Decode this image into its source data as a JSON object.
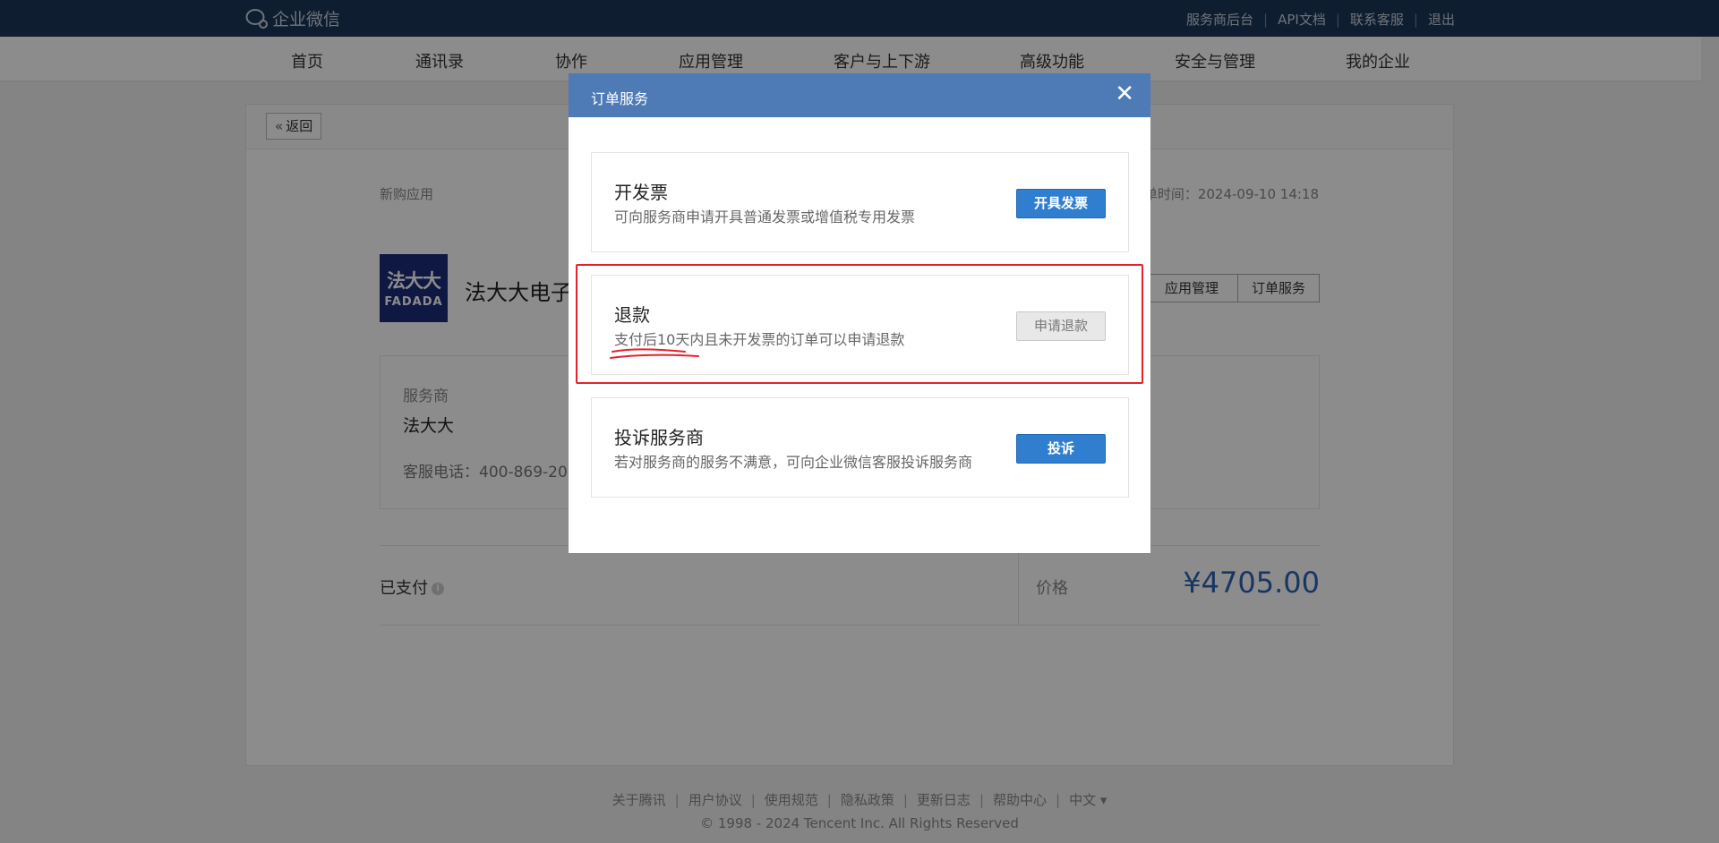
{
  "header": {
    "logo_text": "企业微信",
    "links": [
      "服务商后台",
      "API文档",
      "联系客服",
      "退出"
    ]
  },
  "nav": {
    "items": [
      "首页",
      "通讯录",
      "协作",
      "应用管理",
      "客户与上下游",
      "高级功能",
      "安全与管理",
      "我的企业"
    ]
  },
  "page": {
    "back_label": "返回",
    "sub_label": "新购应用",
    "order_time": "单时间：2024-09-10 14:18",
    "app_logo_cn": "法大大",
    "app_logo_en": "FADADA",
    "app_name": "法大大电子",
    "app_manage_label": "应用管理",
    "order_service_label": "订单服务",
    "provider_label": "服务商",
    "provider_name": "法大大",
    "provider_phone": "客服电话：400-869-20",
    "pay_status": "已支付",
    "price_label": "价格",
    "price_value": "¥4705.00"
  },
  "footer": {
    "links": [
      "关于腾讯",
      "用户协议",
      "使用规范",
      "隐私政策",
      "更新日志",
      "帮助中心",
      "中文 ▾"
    ],
    "copyright": "© 1998 - 2024 Tencent Inc. All Rights Reserved"
  },
  "modal": {
    "title": "订单服务",
    "options": [
      {
        "title": "开发票",
        "desc": "可向服务商申请开具普通发票或增值税专用发票",
        "button": "开具发票"
      },
      {
        "title": "退款",
        "desc": "支付后10天内且未开发票的订单可以申请退款",
        "button": "申请退款"
      },
      {
        "title": "投诉服务商",
        "desc": "若对服务商的服务不满意，可向企业微信客服投诉服务商",
        "button": "投诉"
      }
    ]
  },
  "colors": {
    "topbar": "#1c3558",
    "modal_header": "#4e7ab6",
    "primary_button": "#2f7ecf",
    "price": "#2e63b4",
    "annotation_red": "#e8202a"
  }
}
